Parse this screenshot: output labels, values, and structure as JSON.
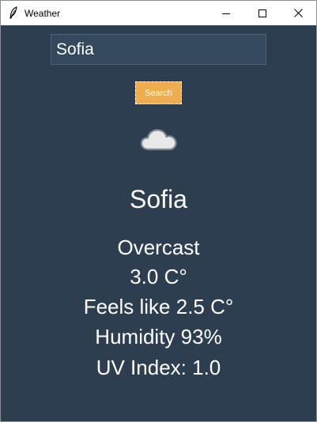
{
  "window": {
    "title": "Weather",
    "icon": "feather-icon",
    "controls": [
      "minimize-icon",
      "maximize-icon",
      "close-icon"
    ]
  },
  "search": {
    "value": "Sofia",
    "button_label": "Search"
  },
  "weather": {
    "icon": "cloud-icon",
    "city": "Sofia",
    "condition": "Overcast",
    "temperature": "3.0 C°",
    "feels_like": "Feels like 2.5 C°",
    "humidity": "Humidity 93%",
    "uv_index": "UV Index: 1.0"
  },
  "colors": {
    "background": "#2c3e50",
    "input_background": "#34495e",
    "button": "#f0ad4e",
    "text": "#ffffff"
  }
}
